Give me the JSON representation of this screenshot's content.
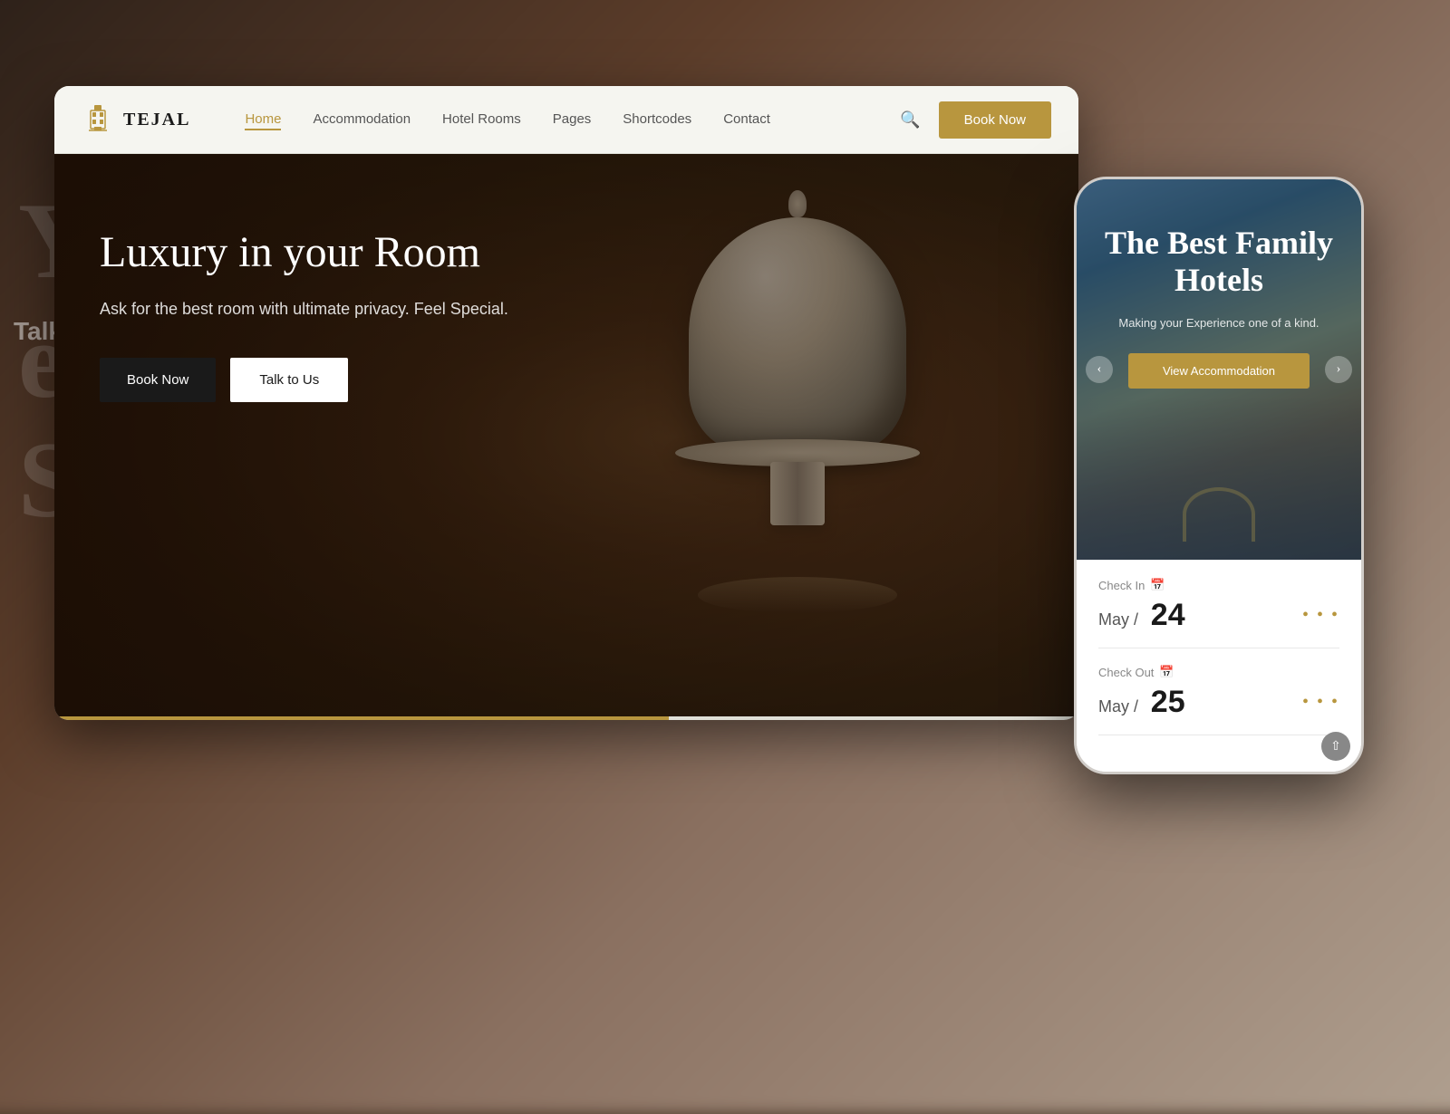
{
  "brand": {
    "name": "TEJAL",
    "logo_label": "building-icon"
  },
  "nav": {
    "links": [
      {
        "label": "Home",
        "active": true
      },
      {
        "label": "Accommodation",
        "active": false
      },
      {
        "label": "Hotel Rooms",
        "active": false
      },
      {
        "label": "Pages",
        "active": false
      },
      {
        "label": "Shortcodes",
        "active": false
      },
      {
        "label": "Contact",
        "active": false
      }
    ],
    "book_now": "Book Now"
  },
  "hero": {
    "title": "Luxury in your Room",
    "subtitle": "Ask for the best room with ultimate privacy. Feel Special.",
    "btn_book": "Book Now",
    "btn_talk": "Talk to Us"
  },
  "mobile": {
    "hero_title": "The Best Family Hotels",
    "hero_subtitle": "Making your Experience one of a kind.",
    "view_btn": "View Accommodation",
    "checkin": {
      "label": "Check In",
      "month": "May /",
      "day": "24"
    },
    "checkout": {
      "label": "Check Out",
      "month": "May /",
      "day": "25"
    }
  },
  "colors": {
    "accent": "#b8963e",
    "dark": "#1a1a1a",
    "white": "#ffffff"
  }
}
